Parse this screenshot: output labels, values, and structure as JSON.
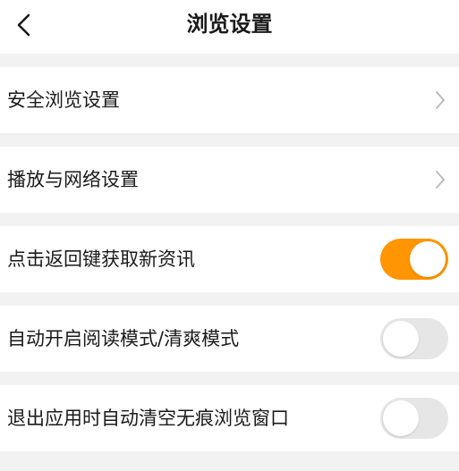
{
  "header": {
    "title": "浏览设置"
  },
  "colors": {
    "accent": "#ff9500",
    "toggle_off": "#e6e6e6",
    "background": "#f2f2f2"
  },
  "settings": [
    {
      "label": "安全浏览设置",
      "control": "chevron"
    },
    {
      "label": "播放与网络设置",
      "control": "chevron"
    },
    {
      "label": "点击返回键获取新资讯",
      "control": "toggle",
      "state": "on"
    },
    {
      "label": "自动开启阅读模式/清爽模式",
      "control": "toggle",
      "state": "off"
    },
    {
      "label": "退出应用时自动清空无痕浏览窗口",
      "control": "toggle",
      "state": "off"
    }
  ]
}
